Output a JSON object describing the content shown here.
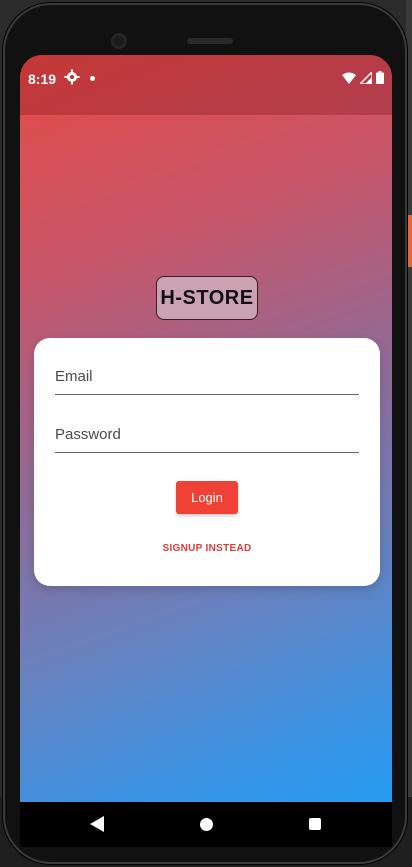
{
  "status_bar": {
    "time": "8:19",
    "icons_left": [
      "gear-icon",
      "notification-dot-icon"
    ],
    "icons_right": [
      "wifi-icon",
      "signal-icon",
      "battery-icon"
    ]
  },
  "app": {
    "logo_text": "H-STORE"
  },
  "login_form": {
    "email_placeholder": "Email",
    "password_placeholder": "Password",
    "login_label": "Login",
    "signup_label": "SIGNUP INSTEAD"
  },
  "nav_bar": {
    "buttons": [
      "back",
      "home",
      "recents"
    ]
  },
  "colors": {
    "gradient_top": "#e54a44",
    "gradient_bottom": "#1b9ef5",
    "accent": "#ef4136",
    "card": "#ffffff",
    "logo_bg": "#caa2b1"
  }
}
